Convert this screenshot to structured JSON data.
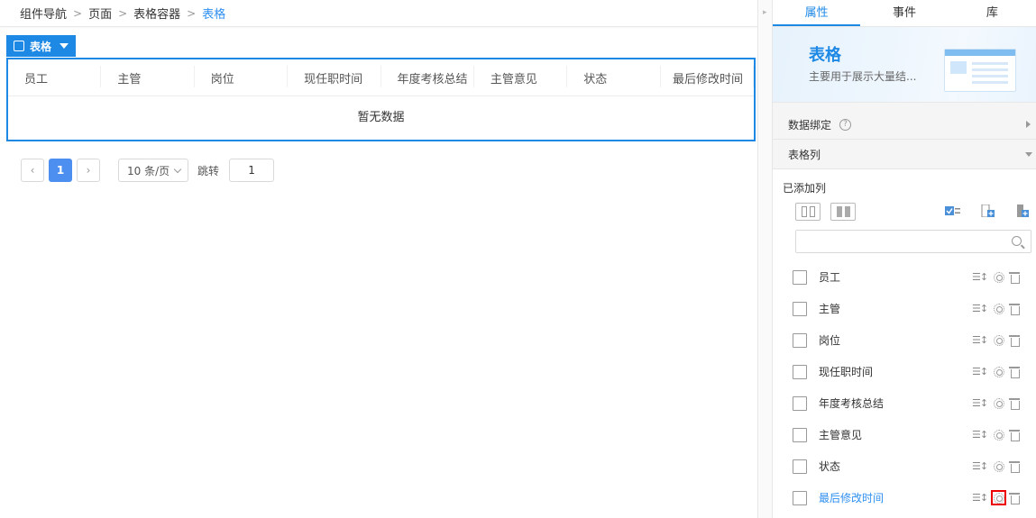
{
  "breadcrumb": {
    "items": [
      "组件导航",
      "页面",
      "表格容器"
    ],
    "current": "表格",
    "separator": ">"
  },
  "widget": {
    "tag_label": "表格",
    "columns": [
      "员工",
      "主管",
      "岗位",
      "现任职时间",
      "年度考核总结",
      "主管意见",
      "状态",
      "最后修改时间"
    ],
    "empty_text": "暂无数据"
  },
  "pagination": {
    "prev_icon": "chevron-left-icon",
    "current_page": "1",
    "next_icon": "chevron-right-icon",
    "page_size": "10 条/页",
    "jump_label": "跳转",
    "jump_value": "1"
  },
  "panel": {
    "tabs": [
      "属性",
      "事件",
      "库"
    ],
    "active_tab": "属性",
    "hero_title": "表格",
    "hero_desc": "主要用于展示大量结...",
    "data_binding_label": "数据绑定",
    "help_glyph": "?",
    "table_columns_label": "表格列",
    "added_columns_label": "已添加列",
    "search_placeholder": "",
    "column_items": [
      {
        "label": "员工",
        "checked": false,
        "active": false
      },
      {
        "label": "主管",
        "checked": false,
        "active": false
      },
      {
        "label": "岗位",
        "checked": false,
        "active": false
      },
      {
        "label": "现任职时间",
        "checked": false,
        "active": false
      },
      {
        "label": "年度考核总结",
        "checked": false,
        "active": false
      },
      {
        "label": "主管意见",
        "checked": false,
        "active": false
      },
      {
        "label": "状态",
        "checked": false,
        "active": false
      },
      {
        "label": "最后修改时间",
        "checked": false,
        "active": true
      }
    ]
  },
  "colors": {
    "accent": "#1e88e5",
    "link": "#2f8ff0",
    "highlight": "#e00000"
  }
}
